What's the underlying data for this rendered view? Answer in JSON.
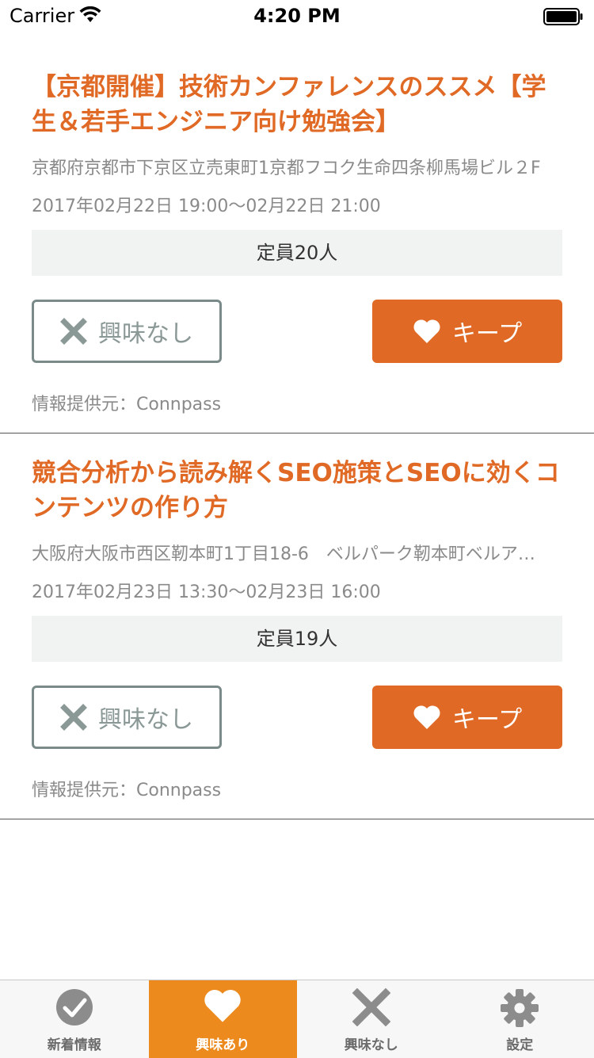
{
  "status_bar": {
    "carrier": "Carrier",
    "time": "4:20 PM"
  },
  "events": [
    {
      "title": "【京都開催】技術カンファレンスのススメ【学生＆若手エンジニア向け勉強会】",
      "location": "京都府京都市下京区立売東町1京都フコク生命四条柳馬場ビル２F",
      "datetime": "2017年02月22日 19:00〜02月22日 21:00",
      "capacity": "定員20人",
      "nope_label": "興味なし",
      "keep_label": "キープ",
      "source": "情報提供元：Connpass"
    },
    {
      "title": "競合分析から読み解くSEO施策とSEOに効くコンテンツの作り方",
      "location": "大阪府大阪市西区靭本町1丁目18-6　ベルパーク靭本町ベルア…",
      "datetime": "2017年02月23日 13:30〜02月23日 16:00",
      "capacity": "定員19人",
      "nope_label": "興味なし",
      "keep_label": "キープ",
      "source": "情報提供元：Connpass"
    }
  ],
  "tabs": [
    {
      "label": "新着情報",
      "icon": "check-circle-icon"
    },
    {
      "label": "興味あり",
      "icon": "heart-icon",
      "active": true
    },
    {
      "label": "興味なし",
      "icon": "x-icon"
    },
    {
      "label": "設定",
      "icon": "gear-icon"
    }
  ],
  "colors": {
    "accent": "#e06a25",
    "tab_active": "#ec8a1d",
    "nope_border": "#7a8a88"
  }
}
